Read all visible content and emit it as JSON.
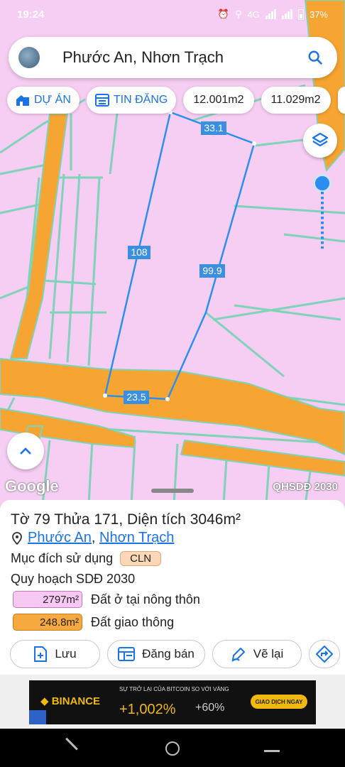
{
  "status_bar": {
    "time": "19:24",
    "network": "4G",
    "battery": "37%"
  },
  "search": {
    "title": "Phước An, Nhơn Trạch"
  },
  "chips": [
    {
      "label": "DỰ ÁN",
      "icon": "building-icon"
    },
    {
      "label": "TIN ĐĂNG",
      "icon": "list-icon"
    },
    {
      "label": "12.001m2"
    },
    {
      "label": "11.029m2"
    }
  ],
  "map": {
    "edge_labels": [
      "33.1",
      "108",
      "99.9",
      "23.5"
    ],
    "attribution": "Google",
    "layer_label": "QHSDĐ 2030"
  },
  "parcel": {
    "title": "Tờ 79 Thửa 171, Diện tích 3046m²",
    "location": {
      "ward": "Phước An",
      "separator": ",",
      "district": "Nhơn Trạch"
    },
    "purpose_label": "Mục đích sử dụng",
    "purpose_code": "CLN",
    "plan_title": "Quy hoạch SDĐ 2030",
    "legend": [
      {
        "area": "2797m²",
        "label": "Đất ở tại nông thôn",
        "color": "#f7c9f2"
      },
      {
        "area": "248.8m²",
        "label": "Đất giao thông",
        "color": "#f5a93f"
      }
    ]
  },
  "actions": [
    {
      "label": "Lưu",
      "icon": "add-file-icon"
    },
    {
      "label": "Đăng bán",
      "icon": "listing-icon"
    },
    {
      "label": "Vẽ lại",
      "icon": "redraw-icon"
    },
    {
      "label": "",
      "icon": "directions-icon"
    }
  ],
  "ad": {
    "brand": "BINANCE",
    "headline": "SỰ TRỞ LẠI CỦA BITCOIN SO VỚI VÀNG",
    "value1": "+1,002%",
    "value2": "+60%",
    "cta": "GIAO DỊCH NGAY"
  }
}
